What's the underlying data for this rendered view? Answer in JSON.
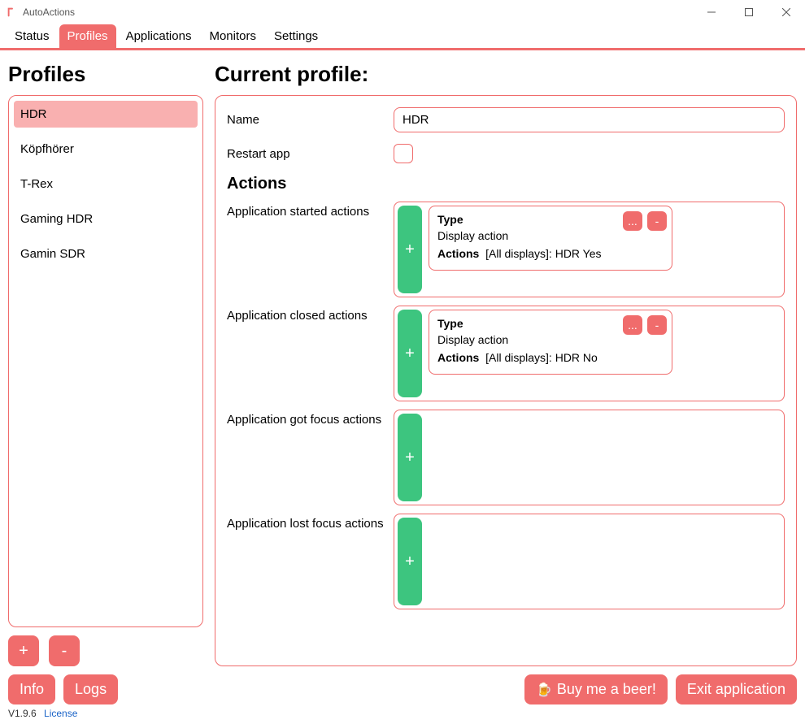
{
  "window": {
    "title": "AutoActions"
  },
  "tabs": [
    {
      "label": "Status",
      "active": false
    },
    {
      "label": "Profiles",
      "active": true
    },
    {
      "label": "Applications",
      "active": false
    },
    {
      "label": "Monitors",
      "active": false
    },
    {
      "label": "Settings",
      "active": false
    }
  ],
  "profiles": {
    "heading": "Profiles",
    "items": [
      {
        "label": "HDR",
        "selected": true
      },
      {
        "label": "Köpfhörer",
        "selected": false
      },
      {
        "label": "T-Rex",
        "selected": false
      },
      {
        "label": "Gaming HDR",
        "selected": false
      },
      {
        "label": "Gamin SDR",
        "selected": false
      }
    ],
    "add_label": "+",
    "remove_label": "-"
  },
  "current_profile": {
    "heading": "Current profile:",
    "name_label": "Name",
    "name_value": "HDR",
    "restart_label": "Restart app",
    "restart_checked": false,
    "actions_heading": "Actions",
    "groups": [
      {
        "label": "Application started actions",
        "add_label": "+",
        "cards": [
          {
            "type_label": "Type",
            "type_value": "Display action",
            "actions_label": "Actions",
            "actions_value": "[All displays]: HDR Yes",
            "edit_label": "...",
            "remove_label": "-"
          }
        ]
      },
      {
        "label": "Application closed actions",
        "add_label": "+",
        "cards": [
          {
            "type_label": "Type",
            "type_value": "Display action",
            "actions_label": "Actions",
            "actions_value": "[All displays]: HDR No",
            "edit_label": "...",
            "remove_label": "-"
          }
        ]
      },
      {
        "label": "Application got focus actions",
        "add_label": "+",
        "cards": []
      },
      {
        "label": "Application lost focus actions",
        "add_label": "+",
        "cards": []
      }
    ]
  },
  "footer": {
    "info_label": "Info",
    "logs_label": "Logs",
    "beer_label": "Buy me a beer!",
    "exit_label": "Exit application",
    "version": "V1.9.6",
    "license_label": "License"
  }
}
